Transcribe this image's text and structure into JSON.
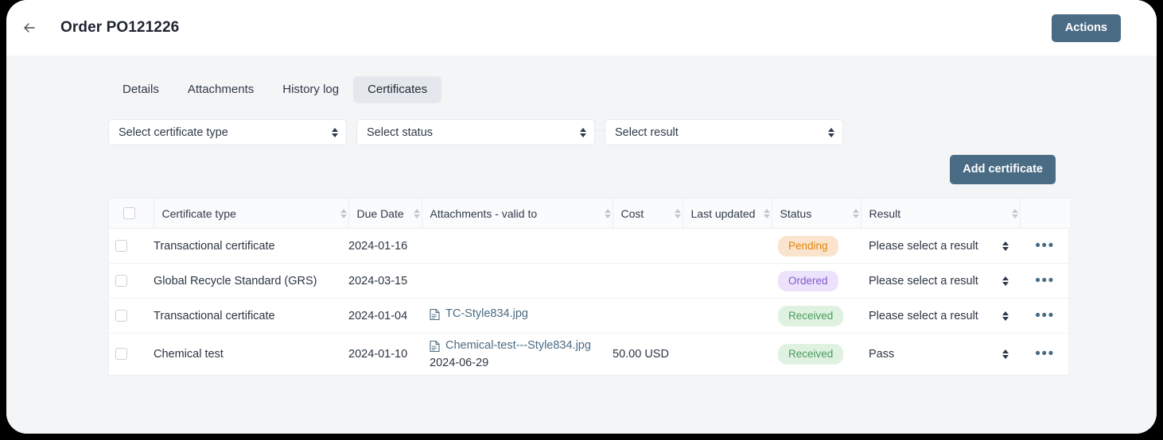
{
  "header": {
    "back_icon": "arrow-left-icon",
    "title": "Order PO121226",
    "actions_label": "Actions"
  },
  "tabs": [
    {
      "label": "Details",
      "active": false
    },
    {
      "label": "Attachments",
      "active": false
    },
    {
      "label": "History log",
      "active": false
    },
    {
      "label": "Certificates",
      "active": true
    }
  ],
  "filters": [
    {
      "name": "certificate-type",
      "value": "Select certificate type"
    },
    {
      "name": "status",
      "value": "Select status"
    },
    {
      "name": "result",
      "value": "Select result"
    }
  ],
  "add_certificate_label": "Add certificate",
  "table": {
    "columns": [
      "Certificate type",
      "Due Date",
      "Attachments - valid to",
      "Cost",
      "Last updated",
      "Status",
      "Result"
    ],
    "rows": [
      {
        "certificate_type": "Transactional certificate",
        "due_date": "2024-01-16",
        "attachment": "",
        "attachment_valid_to": "",
        "cost": "",
        "last_updated": "",
        "status": "Pending",
        "status_variant": "pending",
        "result": "Please select a result",
        "menu": "•••"
      },
      {
        "certificate_type": "Global Recycle Standard (GRS)",
        "due_date": "2024-03-15",
        "attachment": "",
        "attachment_valid_to": "",
        "cost": "",
        "last_updated": "",
        "status": "Ordered",
        "status_variant": "ordered",
        "result": "Please select a result",
        "menu": "•••"
      },
      {
        "certificate_type": "Transactional certificate",
        "due_date": "2024-01-04",
        "attachment": "TC-Style834.jpg",
        "attachment_valid_to": "",
        "cost": "",
        "last_updated": "",
        "status": "Received",
        "status_variant": "received",
        "result": "Please select a result",
        "menu": "•••"
      },
      {
        "certificate_type": "Chemical test",
        "due_date": "2024-01-10",
        "attachment": "Chemical-test---Style834.jpg",
        "attachment_valid_to": "2024-06-29",
        "cost": "50.00 USD",
        "last_updated": "",
        "status": "Received",
        "status_variant": "received",
        "result": "Pass",
        "menu": "•••"
      }
    ]
  },
  "colors": {
    "accent": "#4a6b84",
    "page_background": "#f4f5f7",
    "surface": "#ffffff",
    "badge_pending_text": "#e0840f",
    "badge_pending_bg": "#fbe4cd",
    "badge_ordered_text": "#8259cf",
    "badge_ordered_bg": "#ece2fb",
    "badge_received_text": "#4a9a5c",
    "badge_received_bg": "#dff2e2",
    "link": "#4a6b84"
  }
}
